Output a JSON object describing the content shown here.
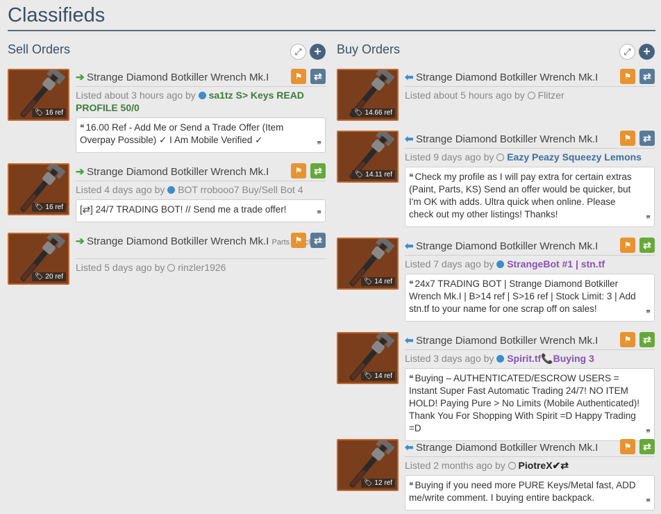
{
  "page": {
    "title": "Classifieds"
  },
  "sell": {
    "title": "Sell Orders",
    "listings": [
      {
        "item": "Strange Diamond Botkiller Wrench Mk.I",
        "price": "16 ref",
        "listed": "Listed about 3 hours ago by",
        "user": "sa1tz S> Keys READ PROFILE 50/0",
        "comment": "16.00 Ref - Add Me or Send a Trade Offer (Item Overpay Possible) ✓ I Am Mobile Verified ✓"
      },
      {
        "item": "Strange Diamond Botkiller Wrench Mk.I",
        "price": "16 ref",
        "listed": "Listed 4 days ago by",
        "user": "BOT rrobooo7 Buy/Sell Bot 4",
        "comment": "[⇄] 24/7 TRADING BOT! // Send me a trade offer!"
      },
      {
        "item": "Strange Diamond Botkiller Wrench Mk.I",
        "item_note": "Parts Attached",
        "price": "20 ref",
        "listed": "Listed 5 days ago by",
        "user": "rinzler1926"
      }
    ]
  },
  "buy": {
    "title": "Buy Orders",
    "listings": [
      {
        "item": "Strange Diamond Botkiller Wrench Mk.I",
        "price": "14.66 ref",
        "listed": "Listed about 5 hours ago by",
        "user": "Flitzer"
      },
      {
        "item": "Strange Diamond Botkiller Wrench Mk.I",
        "price": "14.11 ref",
        "listed": "Listed 9 days ago by",
        "user": "Eazy Peazy Squeezy Lemons",
        "comment": "Check my profile as I will pay extra for certain extras (Paint, Parts, KS) Send an offer would be quicker, but I'm OK with adds. Ultra quick when online. Please check out my other listings! Thanks!"
      },
      {
        "item": "Strange Diamond Botkiller Wrench Mk.I",
        "price": "14 ref",
        "listed": "Listed 7 days ago by",
        "user": "StrangeBot #1 | stn.tf",
        "comment": "24x7 TRADING BOT | Strange Diamond Botkiller Wrench Mk.I | B>14 ref | S>16 ref | Stock Limit: 3 | Add stn.tf to your name for one scrap off on sales!"
      },
      {
        "item": "Strange Diamond Botkiller Wrench Mk.I",
        "price": "14 ref",
        "listed": "Listed 3 days ago by",
        "user": "Spirit.tf📞Buying 3",
        "comment": "Buying – AUTHENTICATED/ESCROW USERS = Instant Super Fast Automatic Trading 24/7! NO ITEM HOLD! Paying Pure > No Limits (Mobile Authenticated)! Thank You For Shopping With Spirit =D Happy Trading =D"
      },
      {
        "item": "Strange Diamond Botkiller Wrench Mk.I",
        "price": "12 ref",
        "listed": "Listed 2 months ago by",
        "user": "PiotreX✔⇄",
        "comment": "Buying if you need more PURE Keys/Metal fast, ADD me/write comment. I buying entire backpack."
      }
    ]
  },
  "icons": {
    "expand": "expand-icon",
    "add": "plus-icon",
    "flag": "flag-icon",
    "trade": "exchange-icon",
    "tag": "tag-icon",
    "quote": "quote-icon"
  },
  "colors": {
    "accent": "#3b5064",
    "item_border": "#c0692f",
    "flag": "#e8932f",
    "trade_slate": "#5a7a96",
    "trade_green": "#67a83a"
  }
}
